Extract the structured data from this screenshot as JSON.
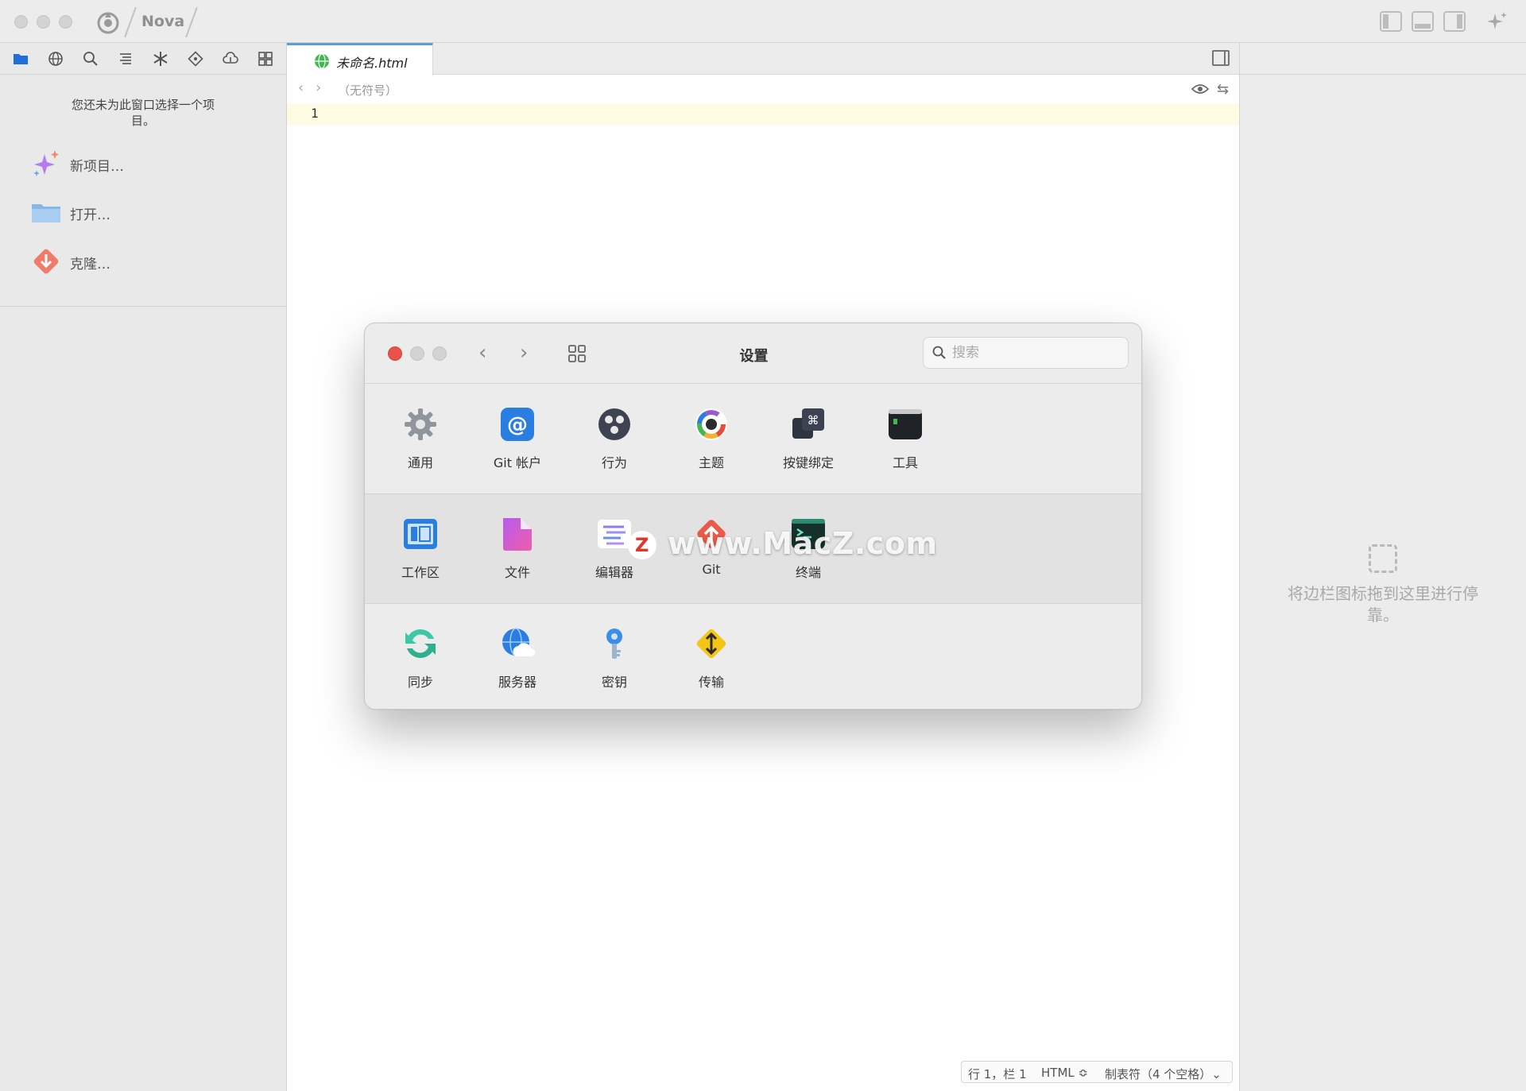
{
  "window": {
    "app_name": "Nova"
  },
  "sidebar": {
    "toolbar_icons": [
      "files-icon",
      "web-icon",
      "search-icon",
      "symbols-icon",
      "clips-icon",
      "git-icon",
      "remote-icon",
      "extensions-icon"
    ],
    "empty_message": "您还未为此窗口选择一个项目。",
    "actions": [
      {
        "label": "新项目…",
        "icon": "sparkle-icon"
      },
      {
        "label": "打开…",
        "icon": "folder-icon"
      },
      {
        "label": "克隆…",
        "icon": "clone-icon"
      }
    ]
  },
  "editor": {
    "tab": {
      "name": "未命名.html"
    },
    "jumpbar": {
      "symbol": "（无符号）"
    },
    "line_number": "1",
    "status": {
      "position": "行 1，栏 1",
      "syntax": "HTML ≎",
      "indent": "制表符（4 个空格）⌄"
    }
  },
  "inspector": {
    "dock_hint": "将边栏图标拖到这里进行停靠。"
  },
  "settings": {
    "title": "设置",
    "search_placeholder": "搜索",
    "rows": [
      [
        {
          "label": "通用",
          "icon": "gear-icon"
        },
        {
          "label": "Git 帐户",
          "icon": "at-icon"
        },
        {
          "label": "行为",
          "icon": "behavior-icon"
        },
        {
          "label": "主题",
          "icon": "theme-icon"
        },
        {
          "label": "按键绑定",
          "icon": "keybinding-icon"
        },
        {
          "label": "工具",
          "icon": "terminal-tool-icon"
        }
      ],
      [
        {
          "label": "工作区",
          "icon": "workspace-icon"
        },
        {
          "label": "文件",
          "icon": "file-icon"
        },
        {
          "label": "编辑器",
          "icon": "editor-icon"
        },
        {
          "label": "Git",
          "icon": "git-up-icon"
        },
        {
          "label": "终端",
          "icon": "terminal-icon"
        }
      ],
      [
        {
          "label": "同步",
          "icon": "sync-icon"
        },
        {
          "label": "服务器",
          "icon": "server-icon"
        },
        {
          "label": "密钥",
          "icon": "key-icon"
        },
        {
          "label": "传输",
          "icon": "transfer-icon"
        }
      ]
    ]
  },
  "watermark": {
    "badge": "Z",
    "text": "www.MacZ.com"
  },
  "colors": {
    "accent": "#5aa0d6",
    "close_red": "#e9524a",
    "line_highlight": "#fdfbe1"
  }
}
